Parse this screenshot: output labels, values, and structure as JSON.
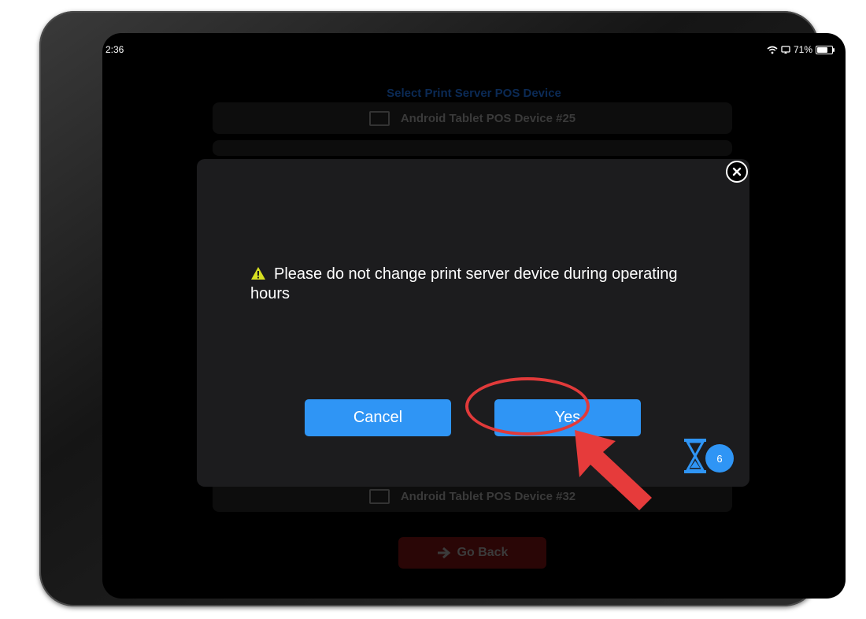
{
  "status_bar": {
    "time": "2:36",
    "battery": "71%",
    "battery_level": 0.71
  },
  "background": {
    "title": "Select Print Server POS Device",
    "items": [
      {
        "label": "Android Tablet POS Device #25"
      },
      {
        "label": "Android Tablet POS Device #32"
      }
    ],
    "go_back_label": "Go Back"
  },
  "modal": {
    "message": "Please do not change print server device during operating hours",
    "cancel_label": "Cancel",
    "yes_label": "Yes",
    "timer_count": "6"
  },
  "colors": {
    "accent_blue": "#2f95f5",
    "warning_yellow": "#d7e021",
    "annotation_red": "#e13a3a"
  },
  "icons": [
    "wifi-icon",
    "screen-mirroring-icon",
    "battery-icon",
    "close-circle-icon",
    "warning-triangle-icon",
    "hourglass-icon",
    "arrow-right-icon"
  ]
}
